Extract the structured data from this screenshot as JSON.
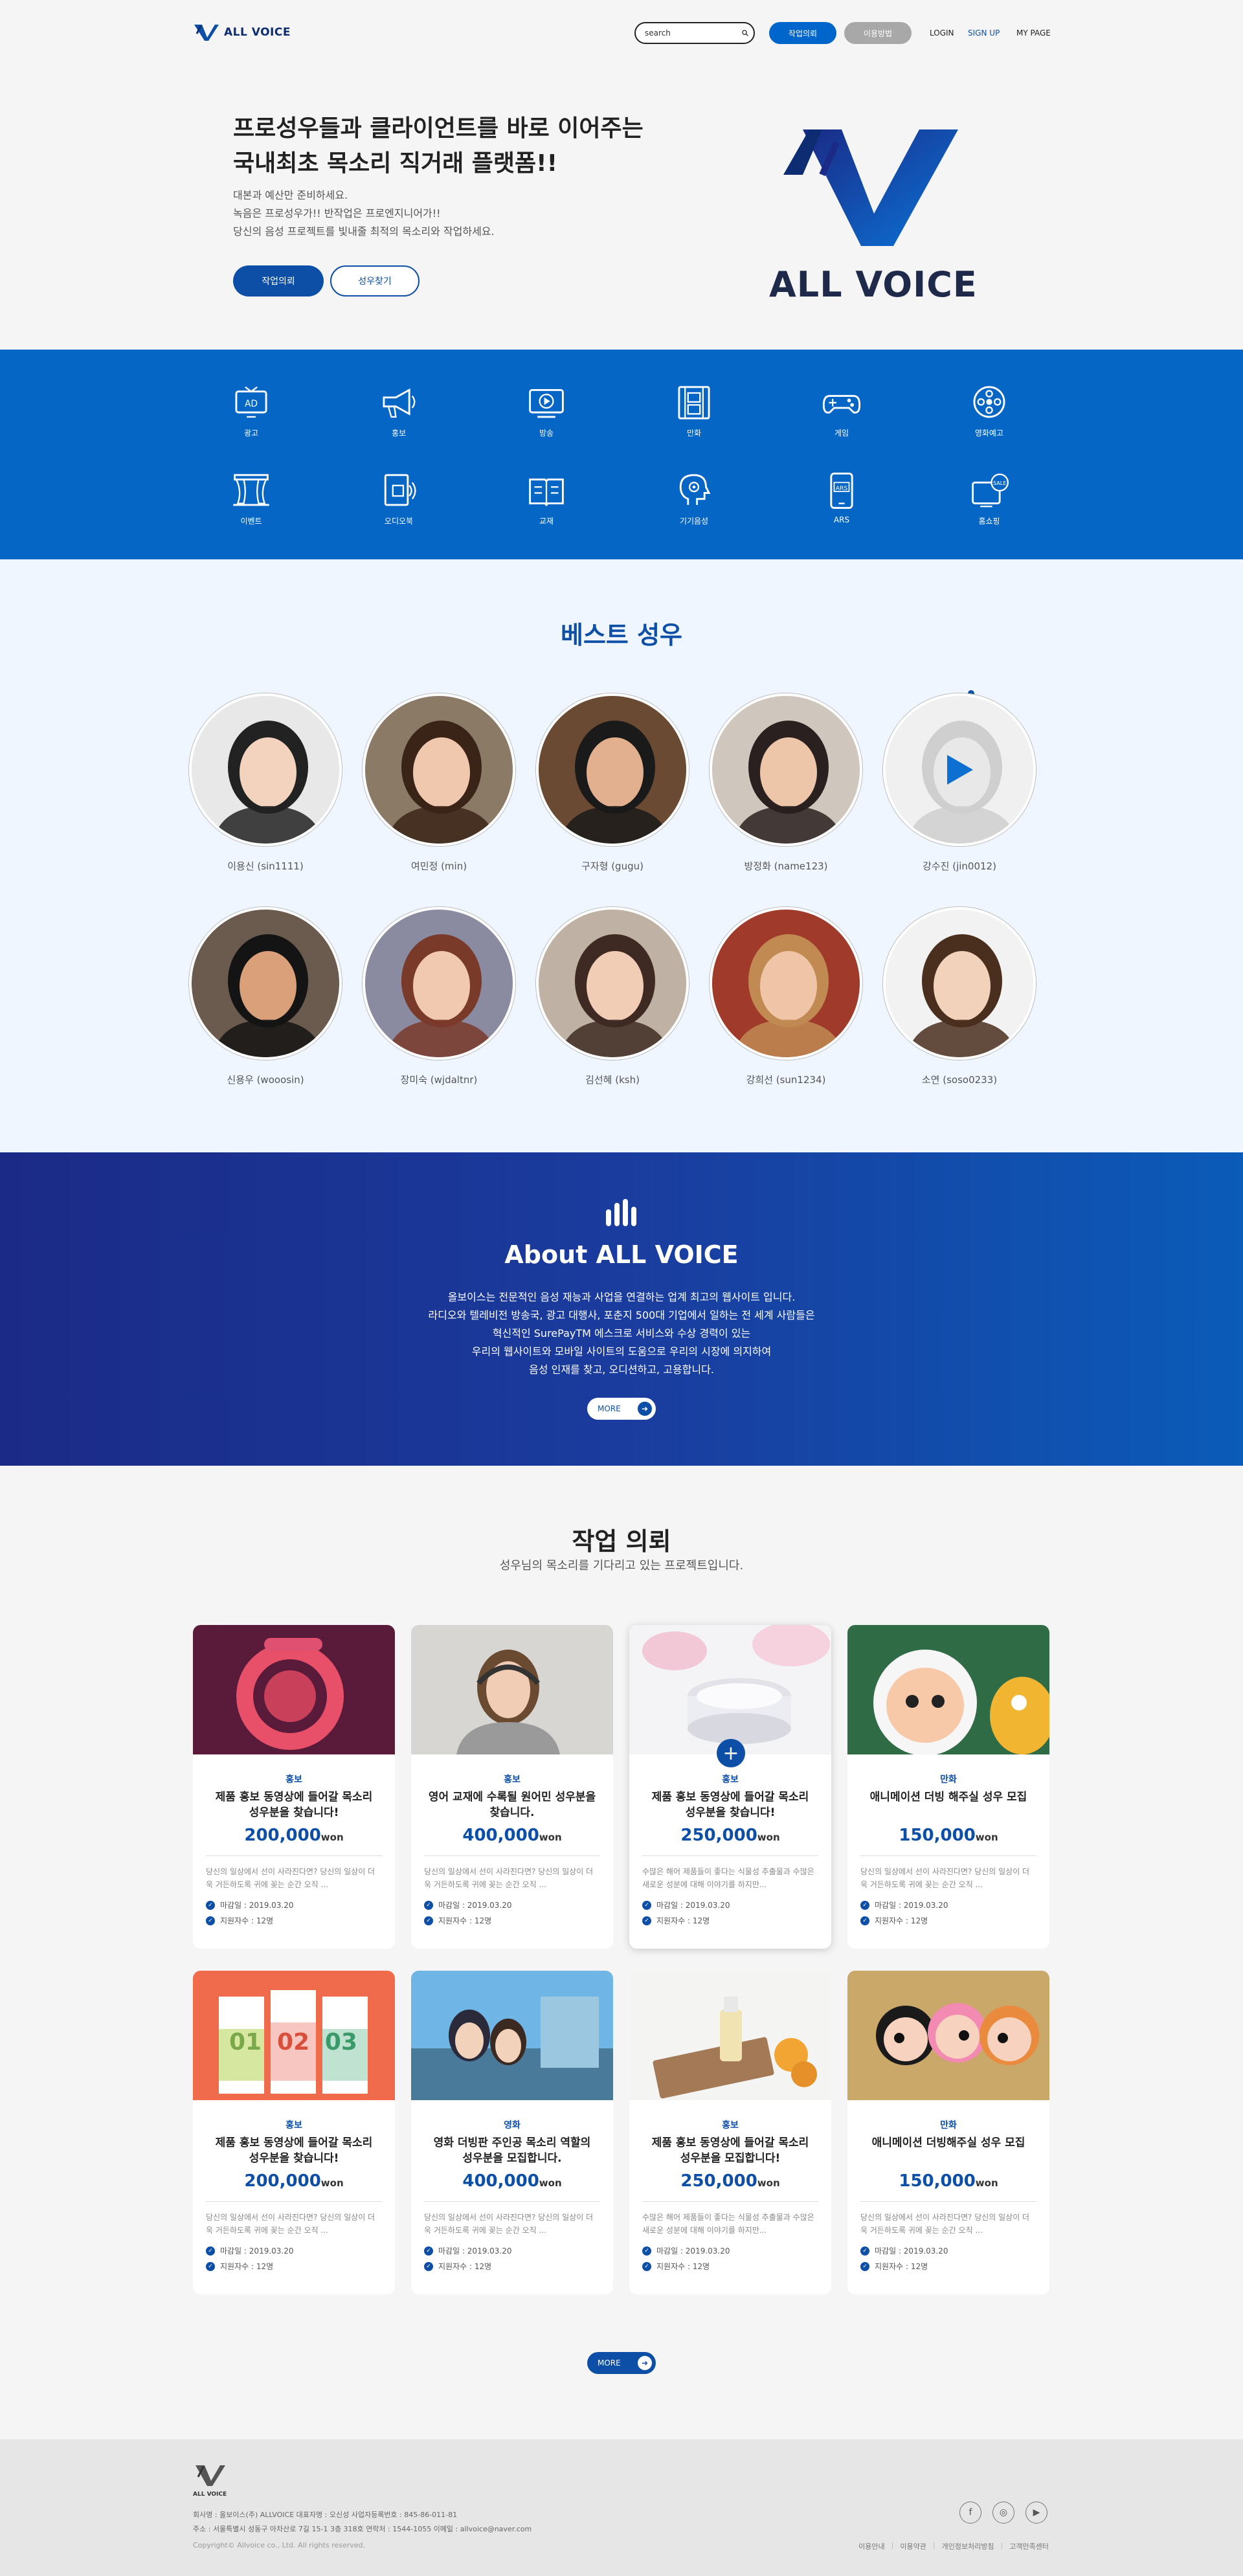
{
  "header": {
    "logo_text": "ALL VOICE",
    "search_placeholder": "search",
    "btn_request": "작업의뢰",
    "btn_guide": "이용방법",
    "nav": {
      "login": "LOGIN",
      "signup": "SIGN UP",
      "mypage": "MY PAGE"
    }
  },
  "hero": {
    "title_line1": "프로성우들과 클라이언트를 바로 이어주는",
    "title_line2": "국내최초 목소리 직거래 플랫폼!!",
    "desc_line1": "대본과 예산만 준비하세요.",
    "desc_line2": "녹음은 프로성우가!! 반작업은 프로엔지니어가!!",
    "desc_line3": "당신의 음성 프로젝트를 빛내줄 최적의 목소리와 작업하세요.",
    "btn_request": "작업의뢰",
    "btn_find": "성우찾기",
    "logo_text": "ALL VOICE"
  },
  "categories": [
    {
      "label": "광고",
      "icon": "tv-ad-icon"
    },
    {
      "label": "홍보",
      "icon": "megaphone-icon"
    },
    {
      "label": "방송",
      "icon": "broadcast-icon"
    },
    {
      "label": "만화",
      "icon": "film-icon"
    },
    {
      "label": "게임",
      "icon": "gamepad-icon"
    },
    {
      "label": "영화예고",
      "icon": "film-reel-icon"
    },
    {
      "label": "이벤트",
      "icon": "stage-icon"
    },
    {
      "label": "오디오북",
      "icon": "audiobook-icon"
    },
    {
      "label": "교재",
      "icon": "book-icon"
    },
    {
      "label": "기기음성",
      "icon": "head-voice-icon"
    },
    {
      "label": "ARS",
      "icon": "phone-ars-icon"
    },
    {
      "label": "홈쇼핑",
      "icon": "tv-sale-icon"
    }
  ],
  "best": {
    "title": "베스트 성우",
    "actors": [
      {
        "name": "이용신 (sin1111)"
      },
      {
        "name": "여민정 (min)"
      },
      {
        "name": "구자형 (gugu)"
      },
      {
        "name": "방정화 (name123)"
      },
      {
        "name": "강수진 (jin0012)"
      },
      {
        "name": "신용우 (wooosin)"
      },
      {
        "name": "장미숙 (wjdaltnr)"
      },
      {
        "name": "김선혜 (ksh)"
      },
      {
        "name": "강희선 (sun1234)"
      },
      {
        "name": "소연 (soso0233)"
      }
    ]
  },
  "about": {
    "title": "About ALL VOICE",
    "line1": "올보이스는 전문적인 음성 재능과 사업을 연결하는 업계 최고의 웹사이트 입니다.",
    "line2": "라디오와 텔레비전 방송국, 광고 대행사, 포춘지 500대 기업에서 일하는 전 세계 사람들은",
    "line3": "혁신적인 SurePayTM 에스크로 서비스와 수상 경력이 있는",
    "line4": "우리의 웹사이트와 모바일 사이트의 도움으로 우리의 시장에 의지하여",
    "line5": "음성 인재를 찾고, 오디션하고, 고용합니다.",
    "more": "MORE"
  },
  "requests": {
    "title": "작업 의뢰",
    "subtitle": "성우님의 목소리를 기다리고 있는 프로젝트입니다.",
    "more": "MORE",
    "deadline_prefix": "마감일 : ",
    "applicants_prefix": "지원자수 : ",
    "won": "won",
    "cards": [
      {
        "category": "홍보",
        "title": "제품 홍보 동영상에 들어갈 목소리 성우분을 찾습니다!",
        "price": "200,000",
        "desc": "당신의 일상에서 선이 사라진다면? 당신의 일상이 더욱 거든하도록 귀에 꽂는 순간 오직 ...",
        "deadline": "2019.03.20",
        "applicants": "12명"
      },
      {
        "category": "홍보",
        "title": "영어 교재에 수록될 원어민 성우분을 찾습니다.",
        "price": "400,000",
        "desc": "당신의 일상에서 선이 사라진다면? 당신의 일상이 더욱 거든하도록 귀에 꽂는 순간 오직 ...",
        "deadline": "2019.03.20",
        "applicants": "12명"
      },
      {
        "category": "홍보",
        "title": "제품 홍보 동영상에 들어갈 목소리 성우분을 찾습니다!",
        "price": "250,000",
        "desc": "수많은 해어 제품들이 좋다는 식물성 추출물과 수많은 새로운 성분에 대해 이야기를 하지만...",
        "deadline": "2019.03.20",
        "applicants": "12명"
      },
      {
        "category": "만화",
        "title": "애니메이션 더빙 해주실 성우 모집",
        "price": "150,000",
        "desc": "당신의 일상에서 선이 사라진다면? 당신의 일상이 더욱 거든하도록 귀에 꽂는 순간 오직 ...",
        "deadline": "2019.03.20",
        "applicants": "12명"
      },
      {
        "category": "홍보",
        "title": "제품 홍보 동영상에 들어갈 목소리 성우분을 찾습니다!",
        "price": "200,000",
        "desc": "당신의 일상에서 선이 사라진다면? 당신의 일상이 더욱 거든하도록 귀에 꽂는 순간 오직 ...",
        "deadline": "2019.03.20",
        "applicants": "12명",
        "img_labels": [
          "01",
          "02",
          "03"
        ]
      },
      {
        "category": "영화",
        "title": "영화 더빙판 주인공 목소리 역할의 성우분을 모집합니다.",
        "price": "400,000",
        "desc": "당신의 일상에서 선이 사라진다면? 당신의 일상이 더욱 거든하도록 귀에 꽂는 순간 오직 ...",
        "deadline": "2019.03.20",
        "applicants": "12명"
      },
      {
        "category": "홍보",
        "title": "제품 홍보 동영상에 들어갈 목소리 성우분을 모집합니다!",
        "price": "250,000",
        "desc": "수많은 해어 제품들이 좋다는 식물성 추출물과 수많은 새로운 성분에 대해 이야기를 하지만...",
        "deadline": "2019.03.20",
        "applicants": "12명"
      },
      {
        "category": "만화",
        "title": "애니메이션 더빙해주실 성우 모집",
        "price": "150,000",
        "desc": "당신의 일상에서 선이 사라진다면? 당신의 일상이 더욱 거든하도록 귀에 꽂는 순간 오직 ...",
        "deadline": "2019.03.20",
        "applicants": "12명"
      }
    ]
  },
  "footer": {
    "logo_text": "ALL VOICE",
    "info1": "회사명 : 올보이스(주) ALLVOICE  대표자명 : 오신성  사업자등록번호 : 845-86-011-81",
    "info2": "주소 : 서울특별시 성동구 아차산로 7길 15-1 3층 318호  연락처 : 1544-1055  이메일 : allvoice@naver.com",
    "copyright": "Copyright© Allvoice co., Ltd. All rights reserved.",
    "links": [
      "이용안내",
      "이용약관",
      "개인정보처리방침",
      "고객만족센터"
    ],
    "social": [
      "f",
      "◎",
      "▶"
    ]
  },
  "colors": {
    "brand_blue": "#0666c6",
    "navy": "#0d4fa6",
    "about_gradient_start": "#1b2a86",
    "about_gradient_end": "#0b5bb8"
  }
}
